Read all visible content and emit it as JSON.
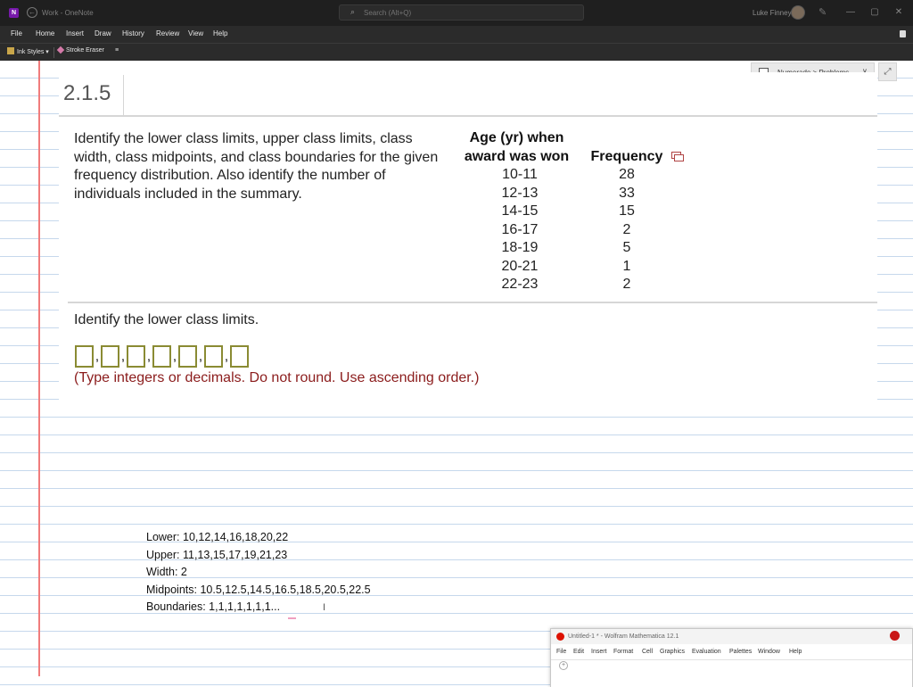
{
  "titlebar": {
    "app_badge": "N",
    "doc_title": "Work - OneNote",
    "search_placeholder": "Search (Alt+Q)",
    "user_name": "Luke Finney",
    "minimize": "—",
    "maximize": "▢",
    "close": "✕"
  },
  "menu": {
    "items": [
      "File",
      "Home",
      "Insert",
      "Draw",
      "History",
      "Review",
      "View",
      "Help"
    ]
  },
  "toolbar": {
    "ink_styles": "Ink Styles",
    "stroke_eraser": "Stroke Eraser",
    "more": "≡"
  },
  "notebook_selector": {
    "label": "Numerade > Problems"
  },
  "problem": {
    "number": "2.1.5",
    "prompt": "Identify the lower class limits, upper class limits, class width, class midpoints, and class boundaries for the given frequency distribution. Also identify the number of individuals included in the summary.",
    "table": {
      "col1_header_line1": "Age (yr) when",
      "col1_header_line2": "award was won",
      "col2_header": "Frequency",
      "rows": [
        {
          "age": "10-11",
          "freq": "28"
        },
        {
          "age": "12-13",
          "freq": "33"
        },
        {
          "age": "14-15",
          "freq": "15"
        },
        {
          "age": "16-17",
          "freq": "2"
        },
        {
          "age": "18-19",
          "freq": "5"
        },
        {
          "age": "20-21",
          "freq": "1"
        },
        {
          "age": "22-23",
          "freq": "2"
        }
      ]
    },
    "question": "Identify the lower class limits.",
    "answer_box_count": 7,
    "hint": "(Type integers or decimals. Do not round. Use ascending order.)"
  },
  "notes": {
    "lines": [
      "Lower: 10,12,14,16,18,20,22",
      "Upper: 11,13,15,17,19,21,23",
      "Width: 2",
      "Midpoints: 10.5,12.5,14.5,16.5,18.5,20.5,22.5",
      "Boundaries: 1,1,1,1,1,1,1..."
    ]
  },
  "mathematica": {
    "title": "Untitled-1 * - Wolfram Mathematica 12.1",
    "menu": [
      "File",
      "Edit",
      "Insert",
      "Format",
      "Cell",
      "Graphics",
      "Evaluation",
      "Palettes",
      "Window",
      "Help"
    ]
  }
}
